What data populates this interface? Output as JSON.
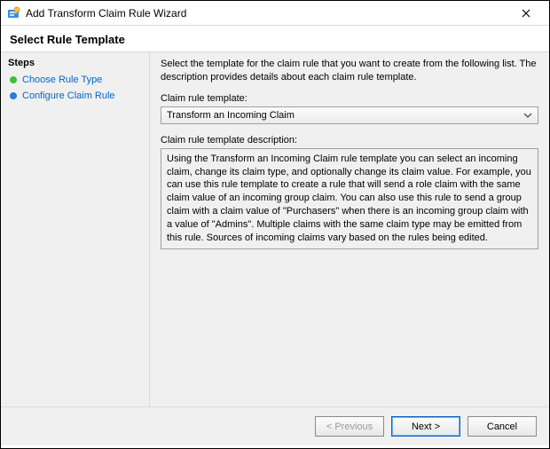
{
  "window": {
    "title": "Add Transform Claim Rule Wizard"
  },
  "page": {
    "heading": "Select Rule Template"
  },
  "steps": {
    "header": "Steps",
    "items": [
      {
        "label": "Choose Rule Type"
      },
      {
        "label": "Configure Claim Rule"
      }
    ]
  },
  "main": {
    "intro": "Select the template for the claim rule that you want to create from the following list. The description provides details about each claim rule template.",
    "template_label": "Claim rule template:",
    "template_selected": "Transform an Incoming Claim",
    "desc_label": "Claim rule template description:",
    "desc_text": "Using the Transform an Incoming Claim rule template you can select an incoming claim, change its claim type, and optionally change its claim value.  For example, you can use this rule template to create a rule that will send a role claim with the same claim value of an incoming group claim.  You can also use this rule to send a group claim with a claim value of \"Purchasers\" when there is an incoming group claim with a value of \"Admins\".  Multiple claims with the same claim type may be emitted from this rule.  Sources of incoming claims vary based on the rules being edited."
  },
  "footer": {
    "previous": "< Previous",
    "next": "Next >",
    "cancel": "Cancel"
  }
}
